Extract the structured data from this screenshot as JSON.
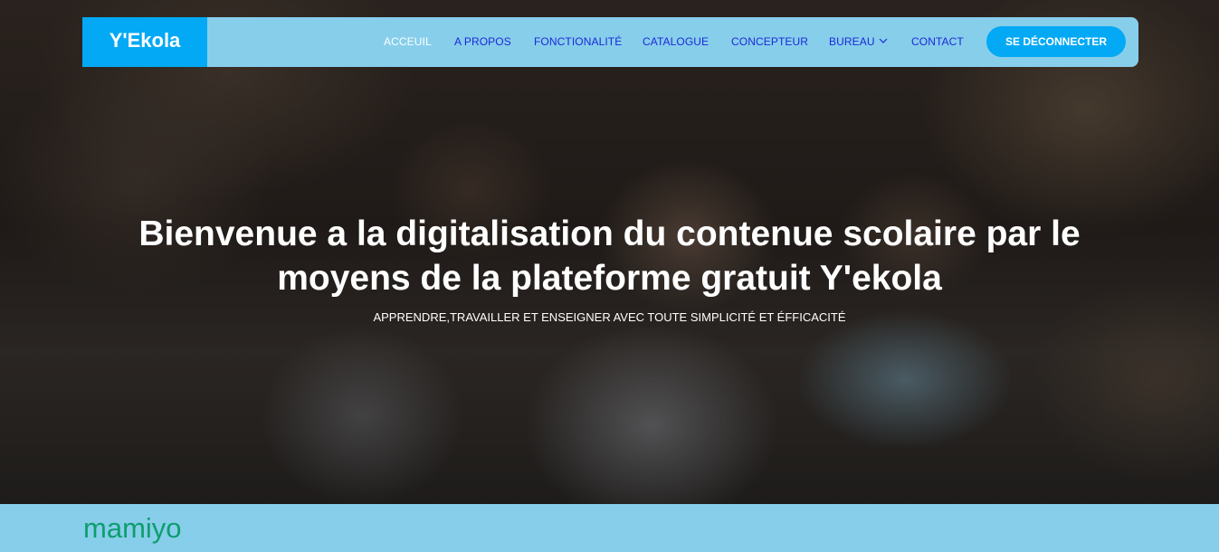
{
  "navbar": {
    "brand": "Y'Ekola",
    "items": [
      {
        "label": "ACCEUIL",
        "active": true
      },
      {
        "label": "A PROPOS"
      },
      {
        "label": "FONCTIONALITÉ"
      },
      {
        "label": "CATALOGUE"
      },
      {
        "label": "CONCEPTEUR"
      },
      {
        "label": "BUREAU",
        "icon": "chevron-down-icon"
      },
      {
        "label": "CONTACT"
      }
    ],
    "logout_label": "SE DÉCONNECTER"
  },
  "hero": {
    "title_line1": "Bienvenue a la digitalisation du contenue scolaire par le",
    "title_line2": "moyens de la plateforme gratuit Y'ekola",
    "subtitle": "APPRENDRE,TRAVAILLER ET ENSEIGNER AVEC TOUTE SIMPLICITÉ ET ÉFFICACITÉ"
  },
  "footer_band": {
    "text": "mamiyo"
  },
  "colors": {
    "nav_bg": "#87ceeb",
    "brand_bg": "#03a9f4",
    "nav_link": "#1a2ad8",
    "band_text": "#0d9e6e"
  }
}
